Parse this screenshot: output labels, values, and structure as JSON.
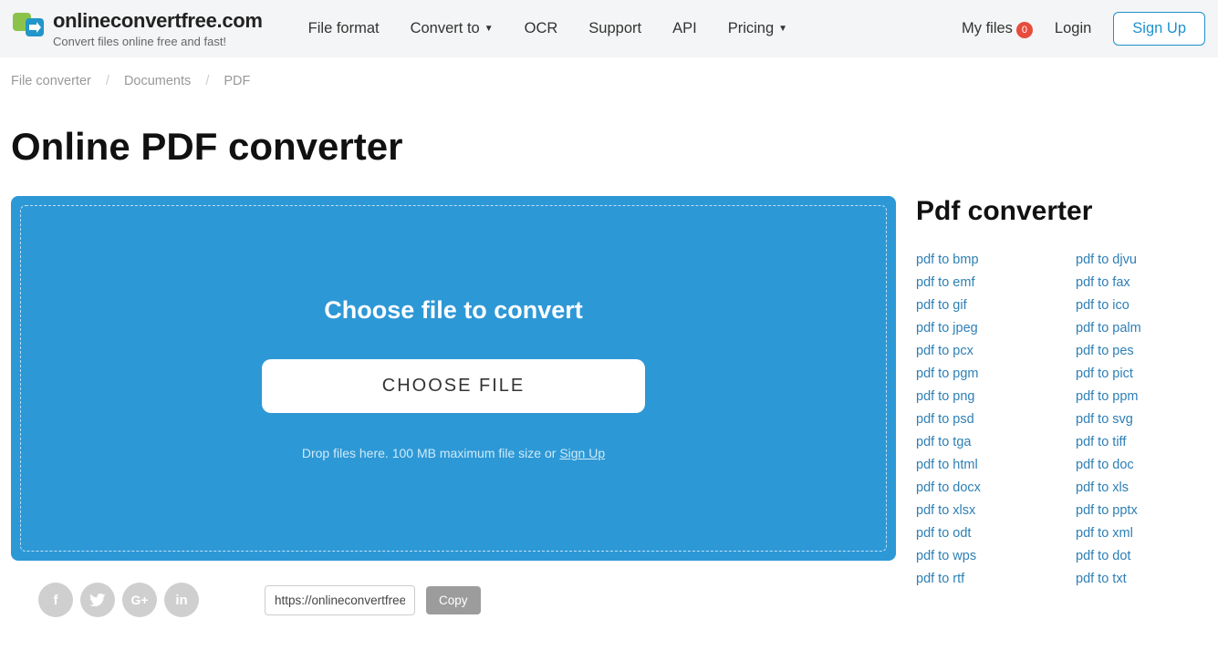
{
  "header": {
    "brand": "onlineconvertfree.com",
    "tagline": "Convert files online free and fast!",
    "nav": {
      "fileformat": "File format",
      "convertto": "Convert to",
      "ocr": "OCR",
      "support": "Support",
      "api": "API",
      "pricing": "Pricing"
    },
    "right": {
      "myfiles": "My files",
      "myfiles_badge": "0",
      "login": "Login",
      "signup": "Sign Up"
    }
  },
  "breadcrumb": {
    "a": "File converter",
    "b": "Documents",
    "c": "PDF"
  },
  "title": "Online PDF converter",
  "dropzone": {
    "title": "Choose file to convert",
    "button": "CHOOSE FILE",
    "hint_pre": "Drop files here. 100 MB maximum file size or ",
    "hint_link": "Sign Up"
  },
  "share": {
    "url": "https://onlineconvertfree.com",
    "copy": "Copy"
  },
  "sidebar": {
    "title": "Pdf converter",
    "col1": [
      "pdf to bmp",
      "pdf to emf",
      "pdf to gif",
      "pdf to jpeg",
      "pdf to pcx",
      "pdf to pgm",
      "pdf to png",
      "pdf to psd",
      "pdf to tga",
      "pdf to html",
      "pdf to docx",
      "pdf to xlsx",
      "pdf to odt",
      "pdf to wps",
      "pdf to rtf"
    ],
    "col2": [
      "pdf to djvu",
      "pdf to fax",
      "pdf to ico",
      "pdf to palm",
      "pdf to pes",
      "pdf to pict",
      "pdf to ppm",
      "pdf to svg",
      "pdf to tiff",
      "pdf to doc",
      "pdf to xls",
      "pdf to pptx",
      "pdf to xml",
      "pdf to dot",
      "pdf to txt"
    ]
  }
}
